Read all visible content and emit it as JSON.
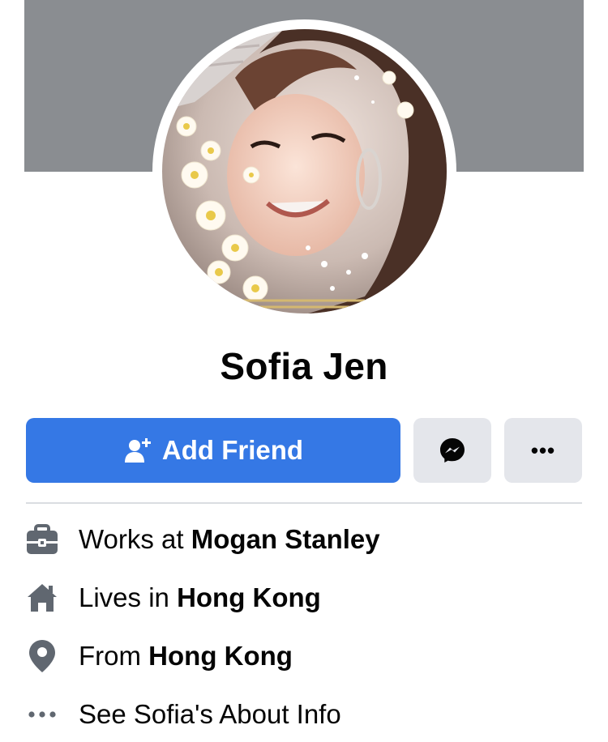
{
  "profile": {
    "name": "Sofia Jen"
  },
  "actions": {
    "add_friend_label": "Add Friend",
    "more_label": "•••"
  },
  "info": {
    "work_prefix": "Works at ",
    "work_value": "Mogan Stanley",
    "lives_prefix": "Lives in ",
    "lives_value": "Hong Kong",
    "from_prefix": "From ",
    "from_value": "Hong Kong",
    "about_label": "See Sofia's About Info"
  },
  "icons": {
    "add_friend": "person-plus-icon",
    "messenger": "messenger-icon",
    "more": "more-dots-icon",
    "work": "briefcase-icon",
    "lives": "home-icon",
    "from": "location-pin-icon",
    "about": "more-dots-icon"
  },
  "colors": {
    "primary": "#3578e5",
    "secondary_button": "#e4e6eb",
    "cover": "#8a8d91",
    "icon_gray": "#606770"
  }
}
